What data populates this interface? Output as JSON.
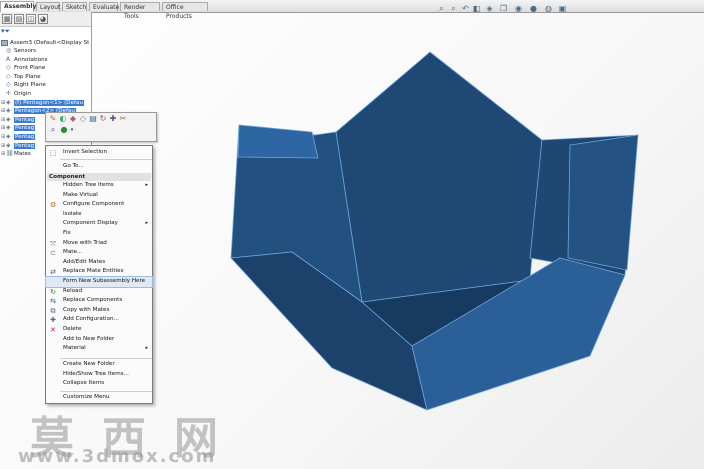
{
  "tabs": [
    {
      "label": "Assembly",
      "active": true
    },
    {
      "label": "Layout"
    },
    {
      "label": "Sketch"
    },
    {
      "label": "Evaluate"
    },
    {
      "label": "Render Tools"
    },
    {
      "label": "Office Products"
    }
  ],
  "feature_tree": {
    "root": "Assem3  (Default<Display St",
    "items": [
      {
        "label": "Sensors",
        "icon": "sensor-icon"
      },
      {
        "label": "Annotations",
        "icon": "annotation-icon"
      },
      {
        "label": "Front Plane",
        "icon": "plane-icon"
      },
      {
        "label": "Top Plane",
        "icon": "plane-icon"
      },
      {
        "label": "Right Plane",
        "icon": "plane-icon"
      },
      {
        "label": "Origin",
        "icon": "origin-icon"
      },
      {
        "label": "(f) Pentagon<1> (Defau",
        "icon": "part-icon",
        "selected": true
      },
      {
        "label": "Pentagon<2> (Defau",
        "icon": "part-icon",
        "selected": true
      },
      {
        "label": "Pentag",
        "icon": "part-icon",
        "selected": true
      },
      {
        "label": "Pentag",
        "icon": "part-icon",
        "selected": true
      },
      {
        "label": "Pentag",
        "icon": "part-icon",
        "selected": true
      },
      {
        "label": "Pentag",
        "icon": "part-icon",
        "selected": true
      },
      {
        "label": "Mates",
        "icon": "mates-icon"
      }
    ]
  },
  "context_menu": {
    "invert_selection": "Invert Selection",
    "goto": "Go To...",
    "category": "Component",
    "items": [
      {
        "label": "Hidden Tree Items",
        "submenu": true
      },
      {
        "label": "Make Virtual"
      },
      {
        "label": "Configure Component",
        "icon": "configure-icon"
      },
      {
        "label": "Isolate"
      },
      {
        "label": "Component Display",
        "submenu": true
      },
      {
        "label": "Fix"
      },
      {
        "label": "Move with Triad",
        "icon": "triad-icon"
      },
      {
        "label": "Mate...",
        "icon": "mate-icon"
      },
      {
        "label": "Add/Edit Mates"
      },
      {
        "label": "Replace Mate Entities",
        "icon": "replace-mate-icon"
      },
      {
        "label": "Form New Subassembly Here",
        "highlighted": true
      },
      {
        "label": "Reload",
        "icon": "reload-icon"
      },
      {
        "label": "Replace Components",
        "icon": "replace-icon"
      },
      {
        "label": "Copy with Mates",
        "icon": "copy-icon"
      },
      {
        "label": "Add Configuration...",
        "icon": "add-config-icon"
      },
      {
        "label": "Delete",
        "icon": "delete-icon"
      },
      {
        "label": "Add to New Folder"
      },
      {
        "label": "Material",
        "submenu": true
      }
    ],
    "bottom_items": [
      {
        "label": "Create New Folder"
      },
      {
        "label": "Hide/Show Tree Items..."
      },
      {
        "label": "Collapse Items"
      }
    ],
    "customize": "Customize Menu"
  },
  "watermark": {
    "text_cn": "莫西网",
    "url": "www.3dmox.com"
  },
  "colors": {
    "model_face": "#24507f",
    "model_light": "#2f6aa6",
    "selection": "#3b7bd4",
    "edge": "#6fa6de"
  }
}
